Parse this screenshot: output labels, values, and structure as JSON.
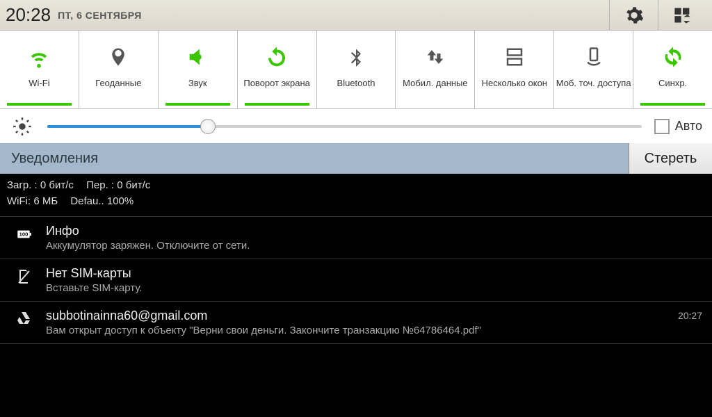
{
  "status": {
    "time": "20:28",
    "date": "ПТ, 6 СЕНТЯБРЯ"
  },
  "toggles": [
    {
      "label": "Wi-Fi",
      "icon": "wifi",
      "active": true
    },
    {
      "label": "Геоданные",
      "icon": "location",
      "active": false
    },
    {
      "label": "Звук",
      "icon": "sound",
      "active": true
    },
    {
      "label": "Поворот экрана",
      "icon": "rotate",
      "active": true
    },
    {
      "label": "Bluetooth",
      "icon": "bluetooth",
      "active": false
    },
    {
      "label": "Мобил. данные",
      "icon": "mobiledata",
      "active": false
    },
    {
      "label": "Несколько окон",
      "icon": "multiwin",
      "active": false
    },
    {
      "label": "Моб. точ. доступа",
      "icon": "hotspot",
      "active": false
    },
    {
      "label": "Синхр.",
      "icon": "sync",
      "active": true
    }
  ],
  "brightness": {
    "percent": 27,
    "auto_label": "Авто",
    "auto_checked": false
  },
  "notifications_header": {
    "title": "Уведомления",
    "clear": "Стереть"
  },
  "netstats": {
    "line1a": "Загр. : 0 бит/с",
    "line1b": "Пер. : 0 бит/с",
    "line2a": "WiFi: 6 МБ",
    "line2b": "Defau.. 100%"
  },
  "notifications": [
    {
      "icon": "battery",
      "title": "Инфо",
      "text": "Аккумулятор заряжен. Отключите от сети.",
      "time": ""
    },
    {
      "icon": "nosim",
      "title": "Нет SIM-карты",
      "text": "Вставьте SIM-карту.",
      "time": ""
    },
    {
      "icon": "drive",
      "title": "subbotinainna60@gmail.com",
      "text": "Вам открыт доступ к объекту \"Верни свои деньги. Закончите транзакцию №64786464.pdf\"",
      "time": "20:27"
    }
  ],
  "colors": {
    "active": "#3ac700",
    "inactive": "#555"
  }
}
